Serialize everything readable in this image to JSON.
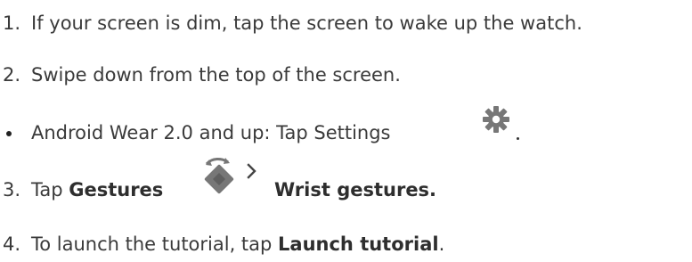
{
  "steps": [
    {
      "marker": "1.",
      "text": "If your screen is dim, tap the screen to wake up the watch."
    },
    {
      "marker": "2.",
      "text": "Swipe down from the top of the screen."
    },
    {
      "marker": "•",
      "text": "Android Wear 2.0 and up: Tap Settings",
      "icon": "gear-icon"
    },
    {
      "marker": "3.",
      "text_prefix": "Tap ",
      "strong_1": "Gestures",
      "icons": [
        "wrist-gesture-icon",
        "chevron-right-icon"
      ],
      "strong_2": "Wrist gestures."
    },
    {
      "marker": "4.",
      "text_prefix": "To launch the tutorial, tap ",
      "strong": "Launch tutorial",
      "suffix": "."
    }
  ],
  "colors": {
    "text": "#3a3a3a",
    "icon_gray": "#777777"
  }
}
